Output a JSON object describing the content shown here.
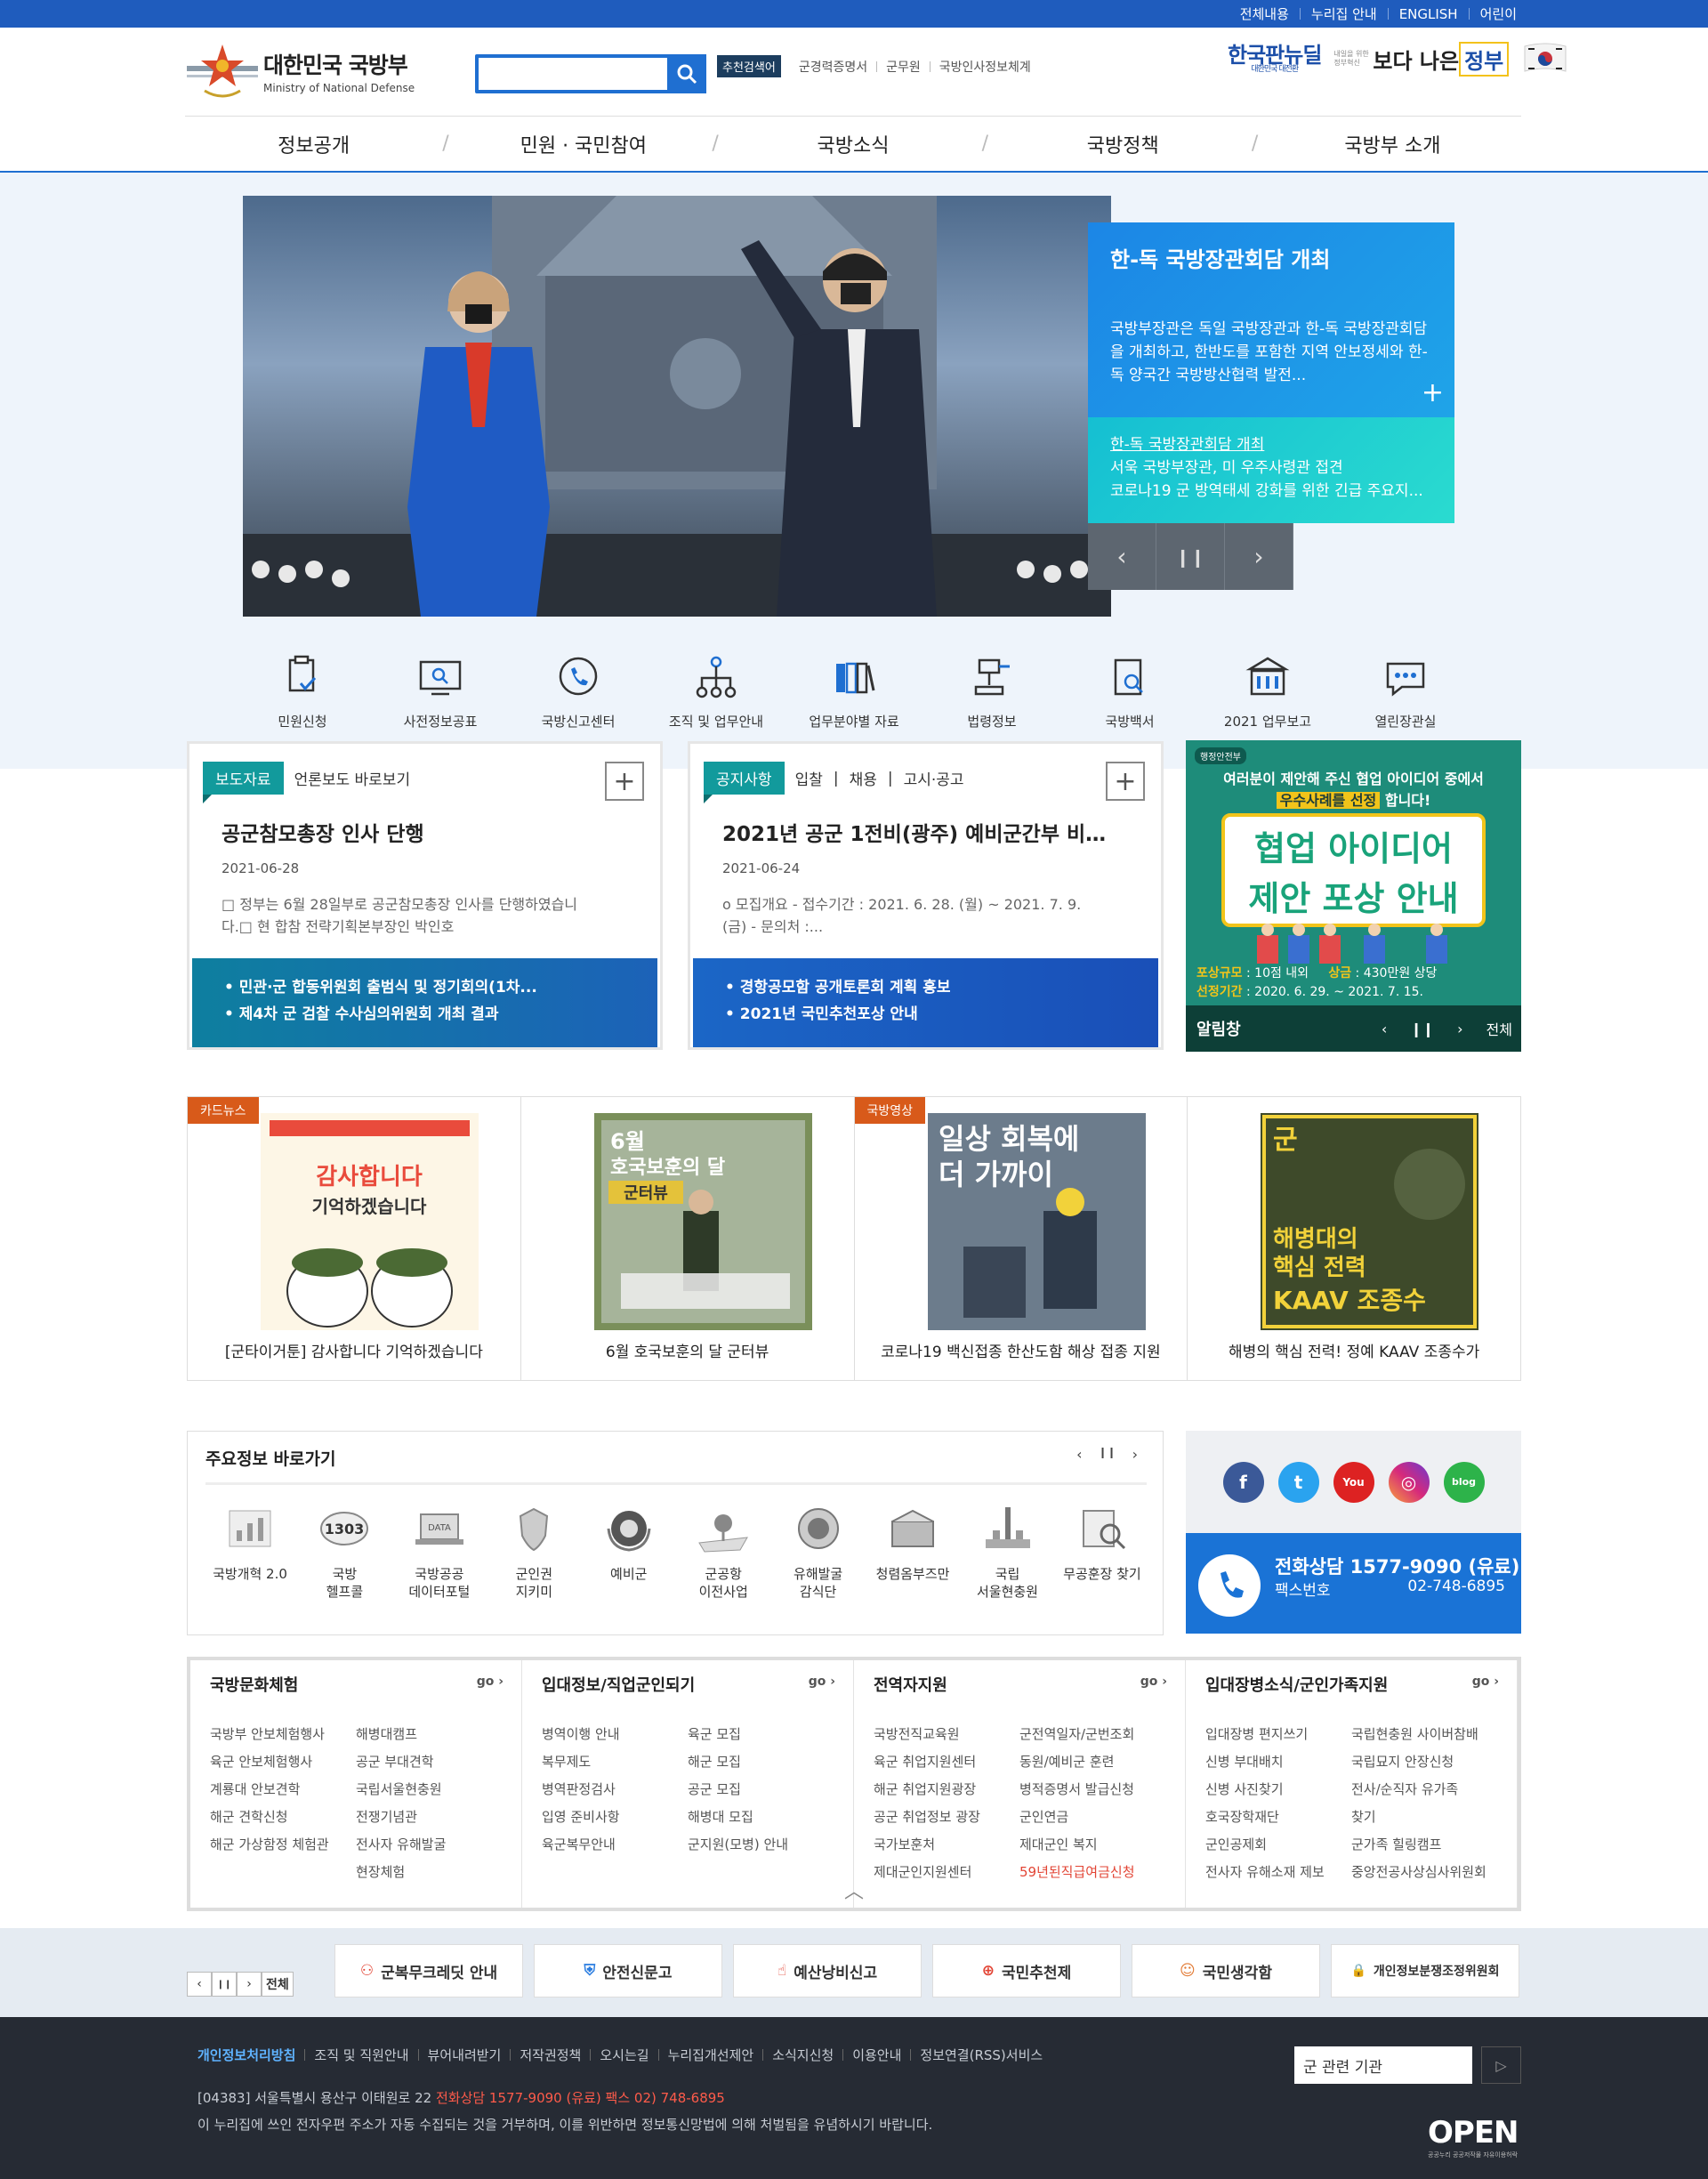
{
  "top_links": [
    "전체내용",
    "누리집 안내",
    "ENGLISH",
    "어린이"
  ],
  "logo": {
    "title": "대한민국 국방부",
    "subtitle": "Ministry of National Defense"
  },
  "search": {
    "placeholder": "",
    "recommend_tag": "추천검색어",
    "recommend": [
      "군경력증명서",
      "군무원",
      "국방인사정보체계"
    ]
  },
  "brand": {
    "newdeal": "한국판뉴딜",
    "newdeal_sub": "대한민국 대전환",
    "gov_pre": "내일을 위한 정부혁신",
    "gov_a": "보다 나은",
    "gov_b": "정부"
  },
  "gnb": [
    "정보공개",
    "민원 · 국민참여",
    "국방소식",
    "국방정책",
    "국방부 소개"
  ],
  "hero": {
    "title": "한-독 국방장관회담 개최",
    "desc": "국방부장관은 독일 국방장관과 한-독 국방장관회담을 개최하고, 한반도를 포함한 지역 안보정세와 한-독 양국간 국방방산협력 발전...",
    "links": [
      "한-독 국방장관회담 개최",
      "서욱 국방부장관, 미 우주사령관 접견",
      "코로나19 군 방역태세 강화를 위한 긴급 주요지..."
    ],
    "controls": [
      "‹",
      "❙❙",
      "›"
    ]
  },
  "quick": [
    "민원신청",
    "사전정보공표",
    "국방신고센터",
    "조직 및 업무안내",
    "업무분야별 자료",
    "법령정보",
    "국방백서",
    "2021 업무보고",
    "열린장관실"
  ],
  "card1": {
    "tabs": [
      "보도자료",
      "언론보도 바로보기"
    ],
    "title": "공군참모총장 인사 단행",
    "date": "2021-06-28",
    "body": "□ 정부는 6월 28일부로 공군참모총장 인사를 단행하였습니다.□ 현 합참 전략기획본부장인 박인호",
    "links": [
      "민관·군 합동위원회 출범식 및 정기회의(1차...",
      "제4차 군 검찰 수사심의위원회 개최 결과"
    ]
  },
  "card2": {
    "tabs": [
      "공지사항",
      "입찰",
      "채용",
      "고시·공고"
    ],
    "title": "2021년 공군 1전비(광주) 예비군간부 비상근 ...",
    "date": "2021-06-24",
    "body": "o 모집개요 - 접수기간 : 2021. 6. 28. (월) ~ 2021. 7. 9. (금) - 문의처 :...",
    "links": [
      "경항공모함 공개토론회 계획 홍보",
      "2021년 국민추천포상 안내"
    ]
  },
  "popup": {
    "org": "행정안전부",
    "line1": "여러분이 제안해 주신 협업 아이디어 중에서",
    "line2_hl": "우수사례를 선정",
    "line2_tail": "합니다!",
    "board1": "협업 아이디어",
    "board2": "제안 포상 안내",
    "size_label": "포상규모",
    "size": "10점 내외",
    "amount_label": "상금",
    "amount": "430만원 상당",
    "period_label": "선정기간",
    "period": "2020. 6. 29. ~ 2021. 7. 15.",
    "bar": "알림창",
    "all": "전체"
  },
  "media": [
    {
      "badge": "카드뉴스",
      "caption": "[군타이거툰] 감사합니다 기억하겠습니다",
      "thumb_text": "감사합니다 기억하겠습니다"
    },
    {
      "badge": "",
      "caption": "6월 호국보훈의 달 군터뷰",
      "thumb_text": "6월 호국보훈의 달 군터뷰"
    },
    {
      "badge": "국방영상",
      "caption": "코로나19 백신접종 한산도함 해상 접종 지원",
      "thumb_text": "일상 회복에 더 가까이"
    },
    {
      "badge": "",
      "caption": "해병의 핵심 전력! 정예 KAAV 조종수가",
      "thumb_text": "해병대의 핵심 전력 KAAV 조종수"
    }
  ],
  "key": {
    "title": "주요정보 바로가기",
    "controls": [
      "‹",
      "❙❙",
      "›"
    ],
    "items": [
      "국방개혁 2.0",
      "국방\n헬프콜",
      "국방공공\n데이터포털",
      "군인권\n지키미",
      "예비군",
      "군공항\n이전사업",
      "유해발굴\n감식단",
      "청렴옴부즈만",
      "국립\n서울현충원",
      "무공훈장 찾기"
    ]
  },
  "sns": {
    "phone_label": "전화상담",
    "phone": "1577-9090 (유료)",
    "fax_label": "팩스번호",
    "fax": "02-748-6895",
    "icons": [
      "f",
      "t",
      "You",
      "◎",
      "blog"
    ]
  },
  "cols": [
    {
      "title": "국방문화체험",
      "go": "go ›",
      "a": [
        "국방부 안보체험행사",
        "육군 안보체험행사",
        "계룡대 안보견학",
        "해군 견학신청",
        "해군 가상함정 체험관"
      ],
      "b": [
        "해병대캠프",
        "공군 부대견학",
        "국립서울현충원",
        "전쟁기념관",
        "전사자 유해발굴\n현장체험"
      ]
    },
    {
      "title": "입대정보/직업군인되기",
      "go": "go ›",
      "a": [
        "병역이행 안내",
        "복무제도",
        "병역판정검사",
        "입영 준비사항",
        "육군복무안내"
      ],
      "b": [
        "육군 모집",
        "해군 모집",
        "공군 모집",
        "해병대 모집",
        "군지원(모병) 안내"
      ]
    },
    {
      "title": "전역자지원",
      "go": "go ›",
      "a": [
        "국방전직교육원",
        "육군 취업지원센터",
        "해군 취업지원광장",
        "공군 취업정보 광장",
        "국가보훈처\n제대군인지원센터"
      ],
      "b": [
        "군전역일자/군번조회",
        "동원/예비군 훈련",
        "병적증명서 발급신청",
        "군인연금",
        "제대군인 복지",
        "59년된직급여금신청"
      ]
    },
    {
      "title": "입대장병소식/군인가족지원",
      "go": "go ›",
      "a": [
        "입대장병 편지쓰기",
        "신병 부대배치",
        "신병 사진찾기",
        "호국장학재단",
        "군인공제회",
        "전사자 유해소재 제보"
      ],
      "b": [
        "국립현충원 사이버참배",
        "국립묘지 안장신청",
        "전사/순직자 유가족\n찾기",
        "군가족 힐링캠프",
        "중앙전공사상심사위원회"
      ]
    }
  ],
  "banner_ctl": [
    "‹",
    "❙❙",
    "›",
    "전체"
  ],
  "banners": [
    "군복무크레딧 안내",
    "안전신문고",
    "예산낭비신고",
    "국민추천제",
    "국민생각함",
    "개인정보분쟁조정위원회"
  ],
  "footer": {
    "links": [
      "개인정보처리방침",
      "조직 및 직원안내",
      "뷰어내려받기",
      "저작권정책",
      "오시는길",
      "누리집개선제안",
      "소식지신청",
      "이용안내",
      "정보연결(RSS)서비스"
    ],
    "addr": "[04383] 서울특별시 용산구 이태원로 22",
    "addr_red": "전화상담 1577-9090 (유료) 팩스 02) 748-6895",
    "note": "이 누리집에 쓰인 전자우편 주소가 자동 수집되는 것을 거부하며, 이를 위반하면 정보통신망법에 의해 처벌됨을 유념하시기 바랍니다.",
    "select": "군 관련 기관",
    "open": "OPEN",
    "open_sub": "공공누리 공공저작물 자유이용허락"
  },
  "colors": {
    "primary": "#1f5cbd",
    "accent": "#1f6fd1",
    "teal": "#129a9c",
    "footer": "#262b34"
  }
}
